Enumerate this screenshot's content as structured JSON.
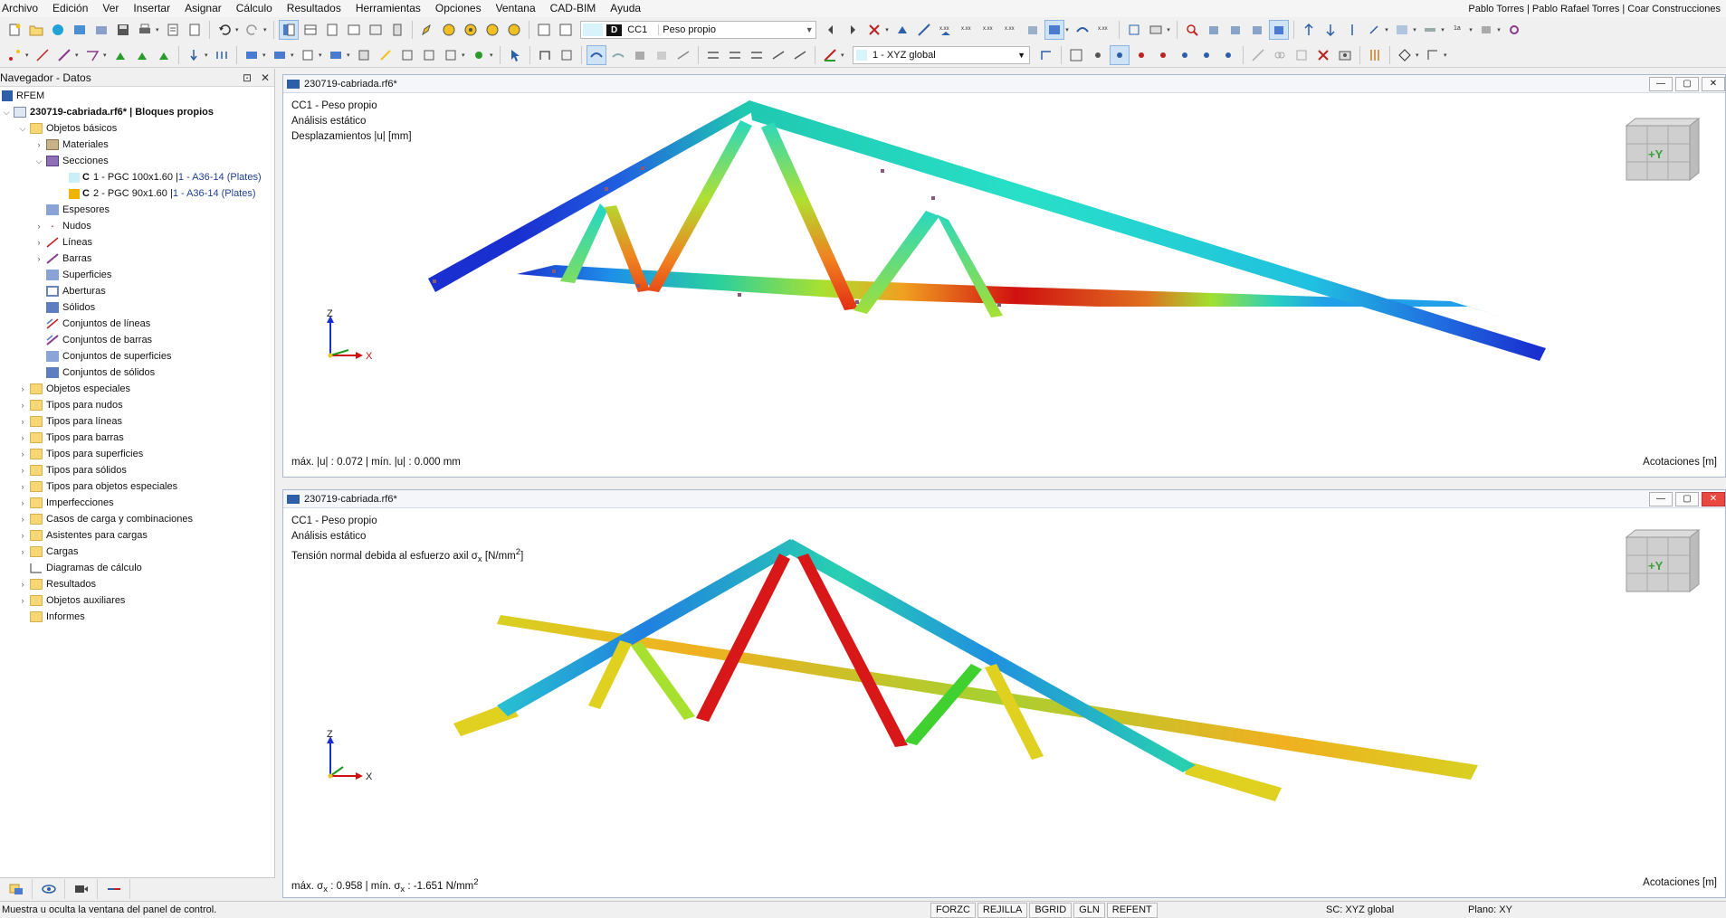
{
  "menu": {
    "items": [
      "Archivo",
      "Edición",
      "Ver",
      "Insertar",
      "Asignar",
      "Cálculo",
      "Resultados",
      "Herramientas",
      "Opciones",
      "Ventana",
      "CAD-BIM",
      "Ayuda"
    ],
    "user": "Pablo Torres | Pablo Rafael Torres | Coar Construcciones"
  },
  "toolbar": {
    "load_case_badge": "D",
    "load_case_code": "CC1",
    "load_case_name": "Peso propio",
    "coordinate_system": "1 - XYZ global"
  },
  "navigator": {
    "title": "Navegador - Datos",
    "root": "RFEM",
    "model": "230719-cabriada.rf6* | Bloques propios",
    "basic_objects": "Objetos básicos",
    "materials": "Materiales",
    "sections": "Secciones",
    "section_items": [
      {
        "name": "1 - PGC 100x1.60 | ",
        "material": "1 - A36-14 (Plates)",
        "color": "#c9f0f7"
      },
      {
        "name": "2 - PGC 90x1.60 | ",
        "material": "1 - A36-14 (Plates)",
        "color": "#f0b400"
      }
    ],
    "sub_items": [
      "Espesores",
      "Nudos",
      "Líneas",
      "Barras",
      "Superficies",
      "Aberturas",
      "Sólidos",
      "Conjuntos de líneas",
      "Conjuntos de barras",
      "Conjuntos de superficies",
      "Conjuntos de sólidos"
    ],
    "top_items": [
      "Objetos especiales",
      "Tipos para nudos",
      "Tipos para líneas",
      "Tipos para barras",
      "Tipos para superficies",
      "Tipos para sólidos",
      "Tipos para objetos especiales",
      "Imperfecciones",
      "Casos de carga y combinaciones",
      "Asistentes para cargas",
      "Cargas",
      "Diagramas de cálculo",
      "Resultados",
      "Objetos auxiliares",
      "Informes"
    ]
  },
  "views": [
    {
      "title": "230719-cabriada.rf6*",
      "case": "CC1 - Peso propio",
      "analysis": "Análisis estático",
      "result": "Desplazamientos |u| [mm]",
      "summary": "máx. |u| : 0.072 | mín. |u| : 0.000 mm",
      "dimension": "Acotaciones [m]"
    },
    {
      "title": "230719-cabriada.rf6*",
      "case": "CC1 - Peso propio",
      "analysis": "Análisis estático",
      "result_prefix": "Tensión normal debida al esfuerzo axil σ",
      "result_sub": "x",
      "result_unit": " [N/mm",
      "result_sup": "2",
      "result_close": "]",
      "summary_a": "máx. σ",
      "summary_sub1": "x",
      "summary_b": " : 0.958 | mín. σ",
      "summary_sub2": "x",
      "summary_c": " : -1.651 N/mm",
      "summary_sup": "2",
      "dimension": "Acotaciones [m]"
    }
  ],
  "axes": {
    "z": "Z",
    "x": "X"
  },
  "view_cube_label": "+Y",
  "status": {
    "message": "Muestra u oculta la ventana del panel de control.",
    "toggles": [
      "FORZC",
      "REJILLA",
      "BGRID",
      "GLN",
      "REFENT"
    ],
    "coord_system": "SC: XYZ global",
    "plane": "Plano: XY"
  },
  "colors": {
    "accent": "#2d5ea8",
    "folder": "#f8d775"
  }
}
